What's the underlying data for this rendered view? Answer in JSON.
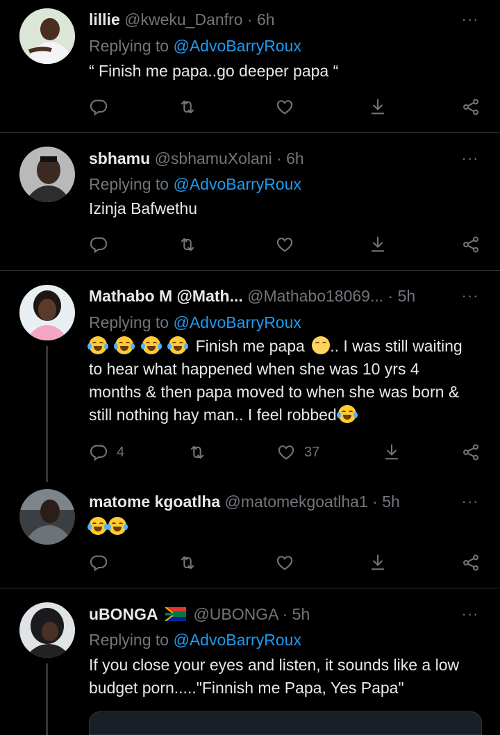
{
  "tweets": [
    {
      "name": "lillie",
      "handle": "@kweku_Danfro",
      "dot": "·",
      "time": "6h",
      "replying_prefix": "Replying to",
      "replying_to": "@AdvoBarryRoux",
      "text": "“ Finish me papa..go deeper papa “",
      "reply_count": "",
      "retweet_count": "",
      "like_count": ""
    },
    {
      "name": "sbhamu",
      "handle": "@sbhamuXolani",
      "dot": "·",
      "time": "6h",
      "replying_prefix": "Replying to",
      "replying_to": "@AdvoBarryRoux",
      "text": "Izinja Bafwethu",
      "reply_count": "",
      "retweet_count": "",
      "like_count": ""
    },
    {
      "name": "Mathabo M @Math...",
      "handle": "@Mathabo18069...",
      "dot": "·",
      "time": "5h",
      "replying_prefix": "Replying to",
      "replying_to": "@AdvoBarryRoux",
      "text_a": "Finish me papa",
      "text_b": ".. I was still",
      "text_c": "waiting to hear what happened when she was 10 yrs 4 months & then papa moved to when she was born & still nothing hay man.. I feel robbed",
      "reply_count": "4",
      "retweet_count": "",
      "like_count": "37"
    },
    {
      "name": "matome kgoatlha",
      "handle": "@matomekgoatlha1",
      "dot": "·",
      "time": "5h",
      "reply_count": "",
      "retweet_count": "",
      "like_count": ""
    },
    {
      "name": "uBONGA",
      "handle": "@UBONGA",
      "dot": "·",
      "time": "5h",
      "replying_prefix": "Replying to",
      "replying_to": "@AdvoBarryRoux",
      "text": "If you close your eyes and listen, it sounds like a low budget porn.....\"Finnish me Papa, Yes Papa\""
    }
  ],
  "more_glyph": "···",
  "icons": [
    "reply-icon",
    "retweet-icon",
    "like-icon",
    "download-icon",
    "share-icon",
    "more-icon",
    "laughing-emoji",
    "woman-facepalm-emoji",
    "south-africa-flag-icon"
  ],
  "colors": {
    "background": "#000000",
    "text": "#e7e9ea",
    "muted": "#71767b",
    "mention": "#1d9bf0",
    "divider": "#2f3336"
  }
}
